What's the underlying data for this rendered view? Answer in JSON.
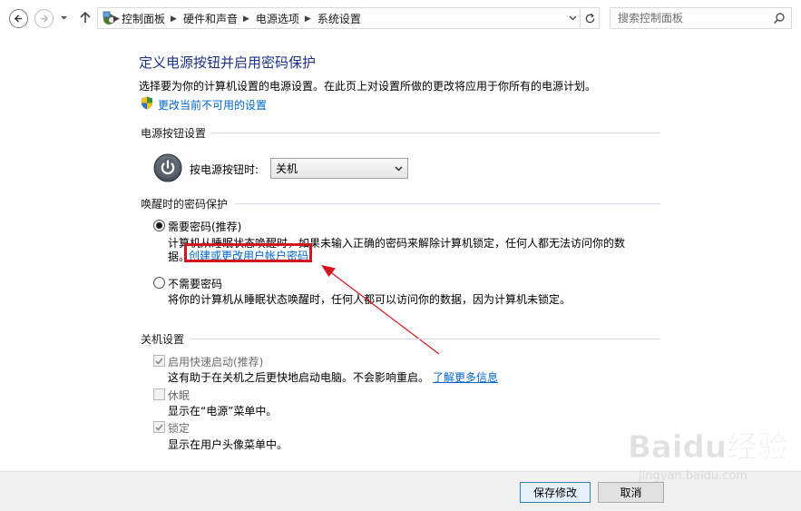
{
  "address_bar": {
    "breadcrumbs": [
      "控制面板",
      "硬件和声音",
      "电源选项",
      "系统设置"
    ],
    "search_placeholder": "搜索控制面板"
  },
  "page": {
    "title": "定义电源按钮并启用密码保护",
    "description": "选择要为你的计算机设置的电源设置。在此页上对设置所做的更改将应用于你所有的电源计划。",
    "change_unavailable_link": "更改当前不可用的设置"
  },
  "power_button_section": {
    "heading": "电源按钮设置",
    "label": "按电源按钮时:",
    "selected_value": "关机"
  },
  "wake_password_section": {
    "heading": "唤醒时的密码保护",
    "options": [
      {
        "label": "需要密码(推荐)",
        "selected": true,
        "desc_line1": "计算机从睡眠状态唤醒时，如果未输入正确的密码来解除计算机锁定，任何人都无法访问你的数",
        "desc_line2_prefix": "据。",
        "link": "创建或更改用户帐户密码"
      },
      {
        "label": "不需要密码",
        "selected": false,
        "desc_line1": "将你的计算机从睡眠状态唤醒时，任何人都可以访问你的数据，因为计算机未锁定。"
      }
    ]
  },
  "shutdown_section": {
    "heading": "关机设置",
    "items": [
      {
        "label": "启用快速启动(推荐)",
        "checked": true,
        "desc": "这有助于在关机之后更快地启动电脑。不会影响重启。",
        "link": "了解更多信息"
      },
      {
        "label": "休眠",
        "checked": false,
        "desc": "显示在“电源”菜单中。"
      },
      {
        "label": "锁定",
        "checked": true,
        "desc": "显示在用户头像菜单中。"
      }
    ]
  },
  "footer": {
    "save_label": "保存修改",
    "cancel_label": "取消"
  },
  "watermark": {
    "text": "Baidu经验",
    "subtext": "jingyan.baidu.com"
  },
  "colors": {
    "title_blue": "#1e3287",
    "link_blue": "#0066cc",
    "highlight_red": "#d3161d"
  }
}
